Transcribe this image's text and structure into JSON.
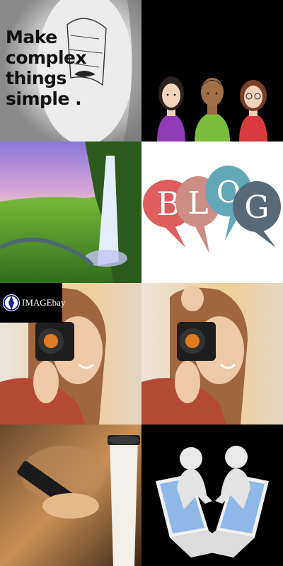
{
  "tiles": {
    "quote": {
      "lines": [
        "Make",
        "complex",
        "things",
        "simple ."
      ]
    },
    "blog": {
      "letters": [
        "B",
        "L",
        "O",
        "G"
      ],
      "colors": [
        "#e05d5d",
        "#cc8d86",
        "#62a8b9",
        "#586977"
      ]
    },
    "imagebay": {
      "logo_text": "IMAGEbay"
    }
  }
}
